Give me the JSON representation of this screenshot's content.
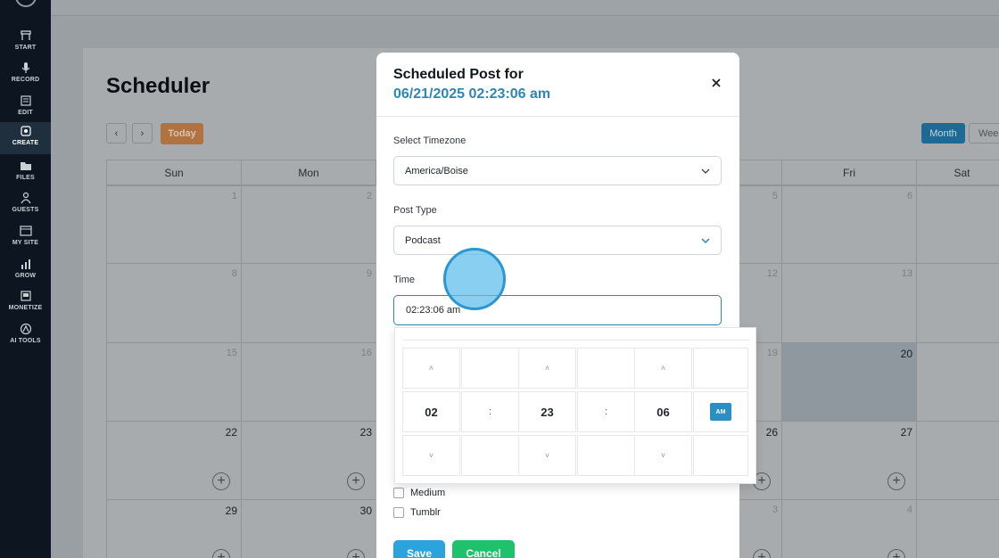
{
  "sidebar": {
    "items": [
      {
        "label": "START",
        "icon": "start-icon"
      },
      {
        "label": "RECORD",
        "icon": "microphone-icon"
      },
      {
        "label": "EDIT",
        "icon": "edit-icon"
      },
      {
        "label": "CREATE",
        "icon": "create-icon",
        "active": true
      },
      {
        "label": "FILES",
        "icon": "folder-icon"
      },
      {
        "label": "GUESTS",
        "icon": "guests-icon"
      },
      {
        "label": "MY SITE",
        "icon": "site-icon"
      },
      {
        "label": "GROW",
        "icon": "chart-icon"
      },
      {
        "label": "MONETIZE",
        "icon": "monetize-icon"
      },
      {
        "label": "AI TOOLS",
        "icon": "ai-icon"
      }
    ]
  },
  "calendar": {
    "title": "Scheduler",
    "prev_icon": "chevron-left-icon",
    "next_icon": "chevron-right-icon",
    "today_label": "Today",
    "month_label": "Month",
    "week_label": "Wee",
    "weekdays": [
      "Sun",
      "Mon",
      "",
      "",
      "",
      "Fri",
      "Sat"
    ],
    "rows": [
      [
        "1",
        "2",
        "",
        "",
        "5",
        "6",
        ""
      ],
      [
        "8",
        "9",
        "",
        "",
        "12",
        "13",
        ""
      ],
      [
        "15",
        "16",
        "",
        "",
        "19",
        "20",
        ""
      ],
      [
        "22",
        "23",
        "",
        "",
        "26",
        "27",
        ""
      ],
      [
        "29",
        "30",
        "",
        "",
        "3",
        "4",
        ""
      ]
    ],
    "add_symbol": "+"
  },
  "modal": {
    "title": "Scheduled Post for",
    "datetime": "06/21/2025 02:23:06 am",
    "close_icon": "close-icon",
    "timezone_label": "Select Timezone",
    "timezone_value": "America/Boise",
    "post_type_label": "Post Type",
    "post_type_value": "Podcast",
    "time_label": "Time",
    "time_value": "02:23:06 am",
    "checkboxes": [
      {
        "label": "Medium",
        "checked": false
      },
      {
        "label": "Tumblr",
        "checked": false
      }
    ],
    "save_label": "Save",
    "cancel_label": "Cancel"
  },
  "time_picker": {
    "hour": "02",
    "minute": "23",
    "second": "06",
    "separator": ":",
    "meridiem": "AM",
    "up_icon": "chevron-up-icon",
    "down_icon": "chevron-down-icon",
    "up_glyph": "˄",
    "down_glyph": "˅"
  },
  "colors": {
    "accent_blue": "#2b87b5",
    "save_blue": "#2ba3dd",
    "cancel_green": "#1fc26b",
    "sidebar_bg": "#0d1620"
  }
}
